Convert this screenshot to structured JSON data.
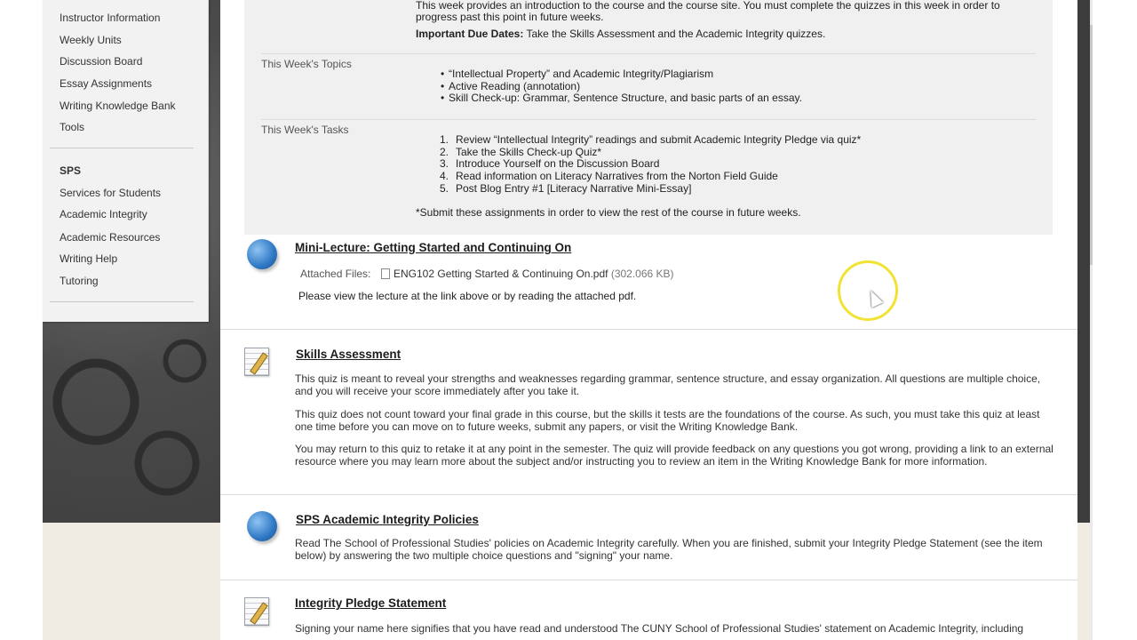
{
  "sidebar": {
    "items": [
      "Instructor Information",
      "Weekly Units",
      "Discussion Board",
      "Essay Assignments",
      "Writing Knowledge Bank",
      "Tools"
    ],
    "section_heading": "SPS",
    "section_items": [
      "Services for Students",
      "Academic Integrity",
      "Academic Resources",
      "Writing Help",
      "Tutoring"
    ]
  },
  "week_info": {
    "intro_line1": "This week provides an introduction to the course and the course site. You must complete the quizzes in this week in order to",
    "intro_line2": "progress past this point in future weeks.",
    "due_label": "Important Due Dates:",
    "due_text": " Take the Skills Assessment and the Academic Integrity quizzes.",
    "topics_label": "This Week's Topics",
    "topics": [
      "“Intellectual Property” and Academic Integrity/Plagiarism",
      "Active Reading (annotation)",
      "Skill Check-up: Grammar, Sentence Structure, and basic parts of an essay."
    ],
    "tasks_label": "This Week's Tasks",
    "tasks": [
      {
        "n": "1.",
        "text": "Review “Intellectual Integrity” readings and submit Academic Integrity Pledge via quiz*"
      },
      {
        "n": "2.",
        "text": "Take the Skills Check-up Quiz*"
      },
      {
        "n": "3.",
        "text": "Introduce Yourself on the Discussion Board"
      },
      {
        "n": "4.",
        "text": "Read information on Literacy Narratives from the Norton Field Guide"
      },
      {
        "n": "5.",
        "text": "Post Blog Entry #1 [Literacy Narrative Mini-Essay]"
      }
    ],
    "submit_note": "*Submit these assignments in order to view the rest of the course in future weeks."
  },
  "items": {
    "mini_lecture": {
      "title": "Mini-Lecture: Getting Started and Continuing On",
      "attached_label": "Attached Files:",
      "file_name": "ENG102 Getting Started & Continuing On.pdf",
      "file_size": "(302.066 KB)",
      "body": "Please view the lecture at the link above or by reading the attached pdf."
    },
    "skills_assessment": {
      "title": "Skills Assessment",
      "p1": "This quiz is meant to reveal your strengths and weaknesses regarding grammar, sentence structure, and essay organization. All questions are multiple choice, and you will receive your score immediately after you take it.",
      "p2": "This quiz does not count toward your final grade in this course, but the skills it tests are the foundations of the course. As such, you must take this quiz at least one time before you can move on to future weeks, submit any papers, or visit the Writing Knowledge Bank.",
      "p3": "You may return to this quiz to retake it at any point in the semester. The quiz will provide feedback on any questions you got wrong, providing a link to an external resource where you may learn more about the subject and/or instructing you to review an item in the Writing Knowledge Bank for more information."
    },
    "sps_policies": {
      "title": "SPS Academic Integrity Policies",
      "body": "Read The School of Professional Studies' policies on Academic Integrity carefully. When you are finished, submit your Integrity Pledge Statement (see the item below) by answering the two multiple choice questions and \"signing\" your name."
    },
    "integrity_pledge": {
      "title": "Integrity Pledge Statement",
      "body": "Signing your name here signifies that you have read and understood The CUNY School of Professional Studies' statement on Academic Integrity, including"
    }
  },
  "icons": {
    "link_item": "globe-link-icon",
    "test_item": "test-clipboard-icon",
    "file": "file-icon"
  },
  "colors": {
    "cursor_highlight": "#f2e233",
    "week_box_bg": "#f0f0f0"
  }
}
